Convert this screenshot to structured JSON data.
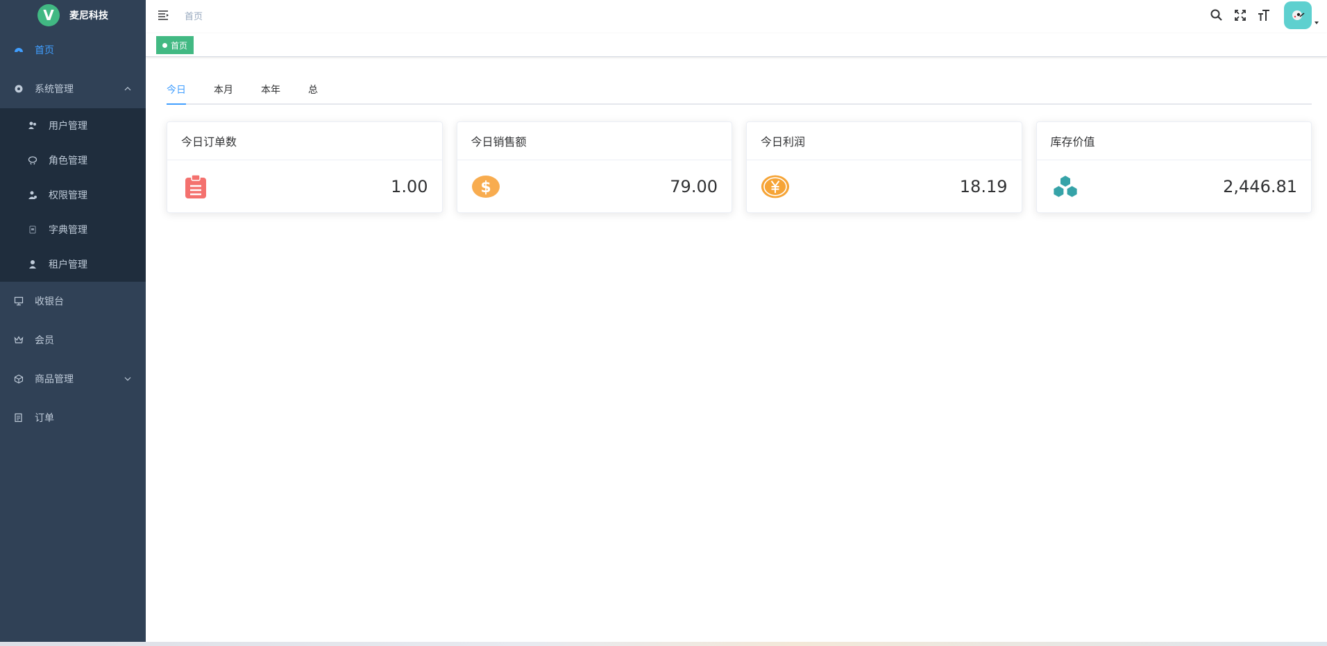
{
  "app": {
    "logo_letter": "V",
    "title": "麦尼科技"
  },
  "sidebar": {
    "items": [
      {
        "label": "首页"
      },
      {
        "label": "系统管理",
        "children": [
          {
            "label": "用户管理"
          },
          {
            "label": "角色管理"
          },
          {
            "label": "权限管理"
          },
          {
            "label": "字典管理"
          },
          {
            "label": "租户管理"
          }
        ]
      },
      {
        "label": "收银台"
      },
      {
        "label": "会员"
      },
      {
        "label": "商品管理"
      },
      {
        "label": "订单"
      }
    ]
  },
  "navbar": {
    "breadcrumb": "首页"
  },
  "tags_view": {
    "active_tag": "首页"
  },
  "tabs": [
    "今日",
    "本月",
    "本年",
    "总"
  ],
  "cards": [
    {
      "title": "今日订单数",
      "value": "1.00",
      "icon": "clipboard-icon",
      "color": "#f4716e"
    },
    {
      "title": "今日销售额",
      "value": "79.00",
      "icon": "dollar-coin-icon",
      "color": "#f8ac4f"
    },
    {
      "title": "今日利润",
      "value": "18.19",
      "icon": "yuan-coin-icon",
      "color": "#f6a436"
    },
    {
      "title": "库存价值",
      "value": "2,446.81",
      "icon": "hexagons-icon",
      "color": "#36a3a8"
    }
  ],
  "colors": {
    "sidebar_bg": "#304156",
    "submenu_bg": "#1f2d3d",
    "active": "#409eff",
    "tag": "#42b983",
    "avatar_bg": "#5ed0cf"
  }
}
